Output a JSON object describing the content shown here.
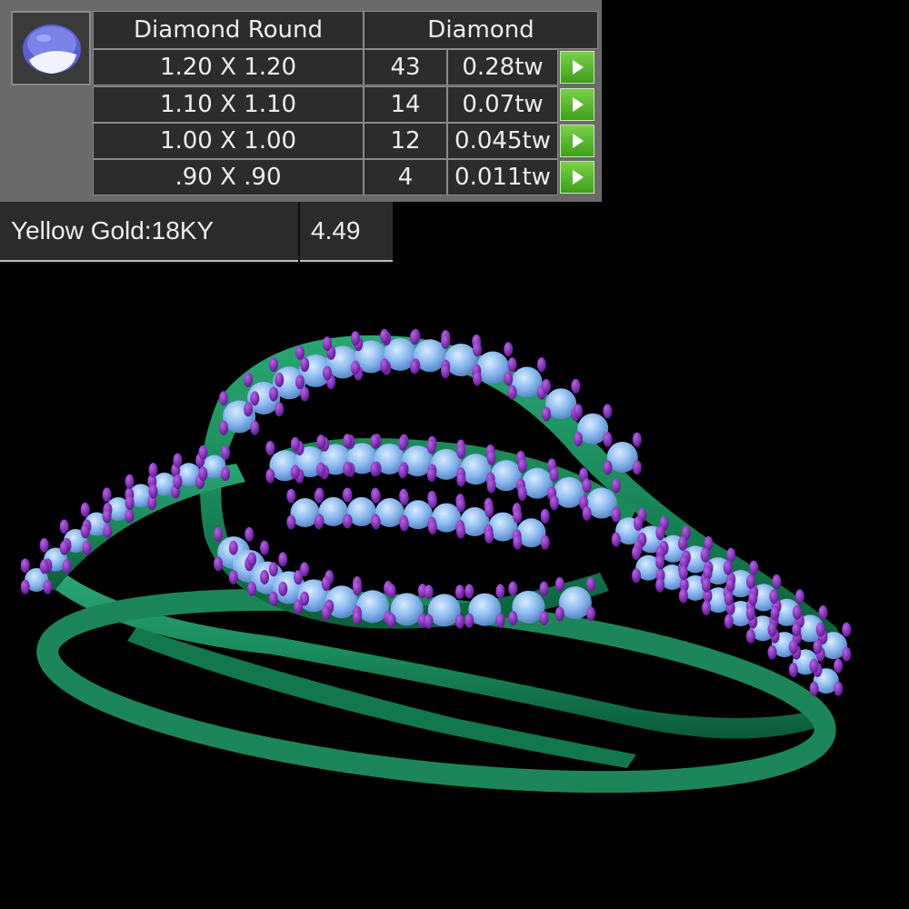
{
  "stone_table": {
    "stone_icon": "round-diamond-icon",
    "shape_header": "Diamond Round",
    "type_header": "Diamond",
    "rows": [
      {
        "size": "1.20 X 1.20",
        "count": "43",
        "weight": "0.28tw"
      },
      {
        "size": "1.10 X 1.10",
        "count": "14",
        "weight": "0.07tw"
      },
      {
        "size": "1.00 X 1.00",
        "count": "12",
        "weight": "0.045tw"
      },
      {
        "size": ".90 X .90",
        "count": "4",
        "weight": "0.011tw"
      }
    ],
    "row_action_icon": "play-arrow-icon"
  },
  "metal": {
    "label": "Yellow Gold:18KY",
    "weight": "4.49"
  },
  "render": {
    "band_color": "#1f8a5c",
    "stone_color": "#7fb2ee",
    "prong_color": "#7a1fb0"
  }
}
